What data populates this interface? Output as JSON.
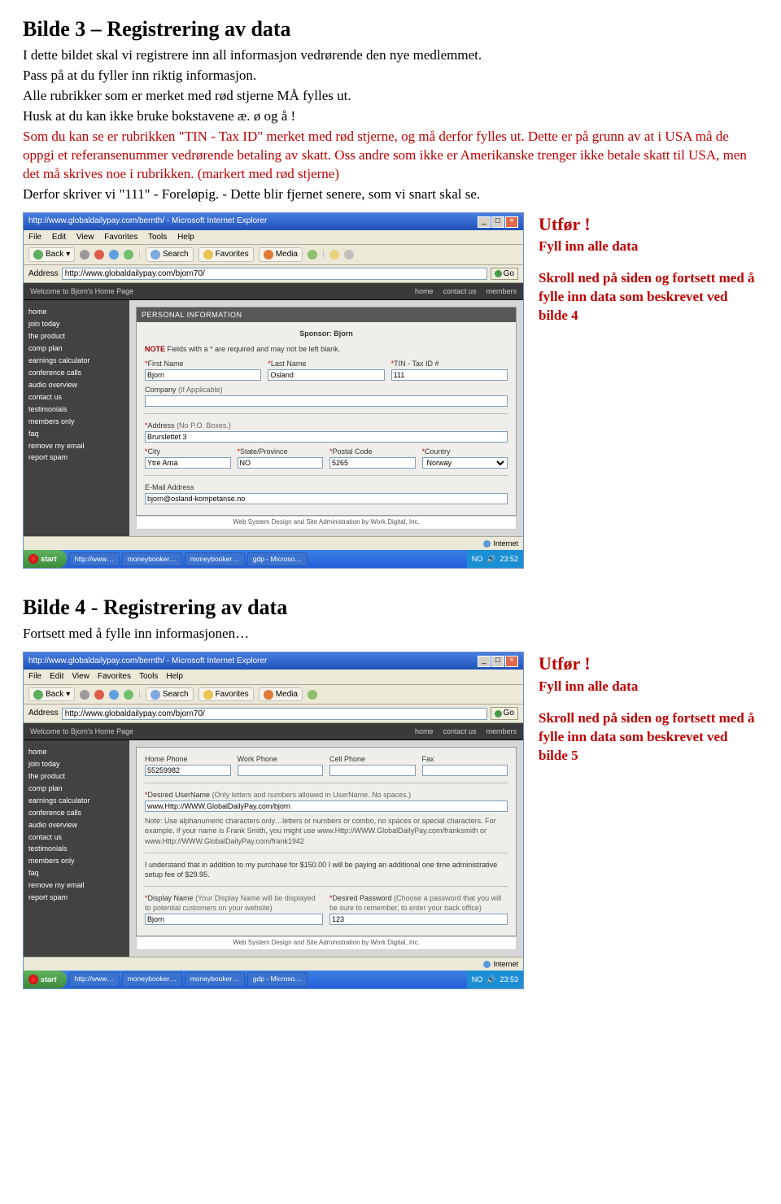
{
  "s3": {
    "heading": "Bilde 3 – Registrering av data",
    "p1": "I dette bildet skal vi registrere inn all informasjon vedrørende den nye medlemmet.",
    "p2": "Pass på at du fyller inn riktig informasjon.",
    "p3": "Alle rubrikker som er merket med rød stjerne MÅ fylles ut.",
    "p4": "Husk at du kan ikke bruke bokstavene æ. ø og å !",
    "p5": "Som du kan se er rubrikken \"TIN - Tax ID\" merket med rød stjerne, og må derfor fylles ut. Dette er på grunn av at i USA må de oppgi et referansenummer vedrørende betaling av skatt. Oss andre som ikke er Amerikanske trenger ikke betale skatt til USA, men det må skrives noe i rubrikken. (markert med rød stjerne)",
    "p6": "Derfor skriver vi \"111\" - Foreløpig. - Dette blir fjernet senere, som vi snart skal se."
  },
  "side3": {
    "title": "Utfør !",
    "l1": "Fyll inn alle data",
    "l2": "Skroll ned på siden og fortsett med å fylle inn data som beskrevet ved bilde 4"
  },
  "s4": {
    "heading": "Bilde 4 - Registrering av data",
    "p1": "Fortsett med å fylle inn informasjonen…"
  },
  "side4": {
    "title": "Utfør !",
    "l1": "Fyll inn alle data",
    "l2": "Skroll ned på siden og fortsett med å fylle inn data som beskrevet ved bilde 5"
  },
  "ie": {
    "title": "http://www.globaldailypay.com/bernth/ - Microsoft Internet Explorer",
    "menu": {
      "file": "File",
      "edit": "Edit",
      "view": "View",
      "fav": "Favorites",
      "tools": "Tools",
      "help": "Help"
    },
    "tb": {
      "back": "Back",
      "search": "Search",
      "favorites": "Favorites",
      "media": "Media"
    },
    "addrLabel": "Address",
    "url": "http://www.globaldailypay.com/bjorn70/",
    "go": "Go",
    "welcome": "Welcome to Bjorn's Home Page",
    "nav": {
      "home": "home",
      "contact": "contact us",
      "members": "members"
    },
    "leftnav": [
      "home",
      "join today",
      "the product",
      "comp plan",
      "earnings calculator",
      "conference calls",
      "audio overview",
      "contact us",
      "testimonials",
      "members only",
      "faq",
      "remove my email",
      "report spam"
    ],
    "status": {
      "done": "",
      "net": "Internet"
    },
    "footer": "Web System Design and Site Administration by Work Digital, Inc."
  },
  "form3": {
    "header": "PERSONAL INFORMATION",
    "sponsor": "Sponsor: Bjorn",
    "noteLabel": "NOTE",
    "note": "Fields with a * are required and may not be left blank.",
    "fn": {
      "label": "First Name",
      "val": "Bjorn"
    },
    "ln": {
      "label": "Last Name",
      "val": "Osland"
    },
    "tin": {
      "label": "TIN - Tax ID #",
      "val": "111"
    },
    "company": {
      "label": "Company",
      "hint": "(If Applicable)",
      "val": ""
    },
    "addr": {
      "label": "Address",
      "hint": "(No P.O. Boxes.)",
      "val": "Brurslettet 3"
    },
    "city": {
      "label": "City",
      "val": "Ytre Arna"
    },
    "state": {
      "label": "State/Province",
      "val": "NO"
    },
    "postal": {
      "label": "Postal Code",
      "val": "5265"
    },
    "country": {
      "label": "Country",
      "val": "Norway"
    },
    "email": {
      "label": "E-Mail Address",
      "val": "bjorn@osland-kompetanse.no"
    }
  },
  "form4": {
    "hp": {
      "label": "Home Phone",
      "val": "55259982"
    },
    "wp": {
      "label": "Work Phone",
      "val": ""
    },
    "cp": {
      "label": "Cell Phone",
      "val": ""
    },
    "fax": {
      "label": "Fax",
      "val": ""
    },
    "uname": {
      "label": "Desired UserName",
      "hint": "(Only letters and numbers allowed in UserName. No spaces.)",
      "val": "www.Http://WWW.GlobalDailyPay.com/bjorn"
    },
    "noteTxt": "Note: Use alphanumeric characters only…letters or numbers or combo, no spaces or special characters. For example, if your name is Frank Smith, you might use www.Http://WWW.GlobalDailyPay.com/franksmith or www.Http://WWW.GlobalDailyPay.com/frank1942",
    "understand": "I understand that in addition to my purchase for $150.00 I will be paying an additional one time administrative setup fee of $29.95.",
    "disp": {
      "label": "Display Name",
      "hint": "(Your Display Name will be displayed to potential customers on your website)",
      "val": "Bjorn"
    },
    "pwd": {
      "label": "Desired Password",
      "hint": "(Choose a password that you will be sure to remember, to enter your back office)",
      "val": "123"
    }
  },
  "taskbar": {
    "start": "start",
    "t1": "http://www…",
    "t2": "moneybooker…",
    "t3": "moneybooker…",
    "t4": "gdp - Microso…",
    "lang": "NO",
    "time": "23:52",
    "time2": "23:53"
  }
}
